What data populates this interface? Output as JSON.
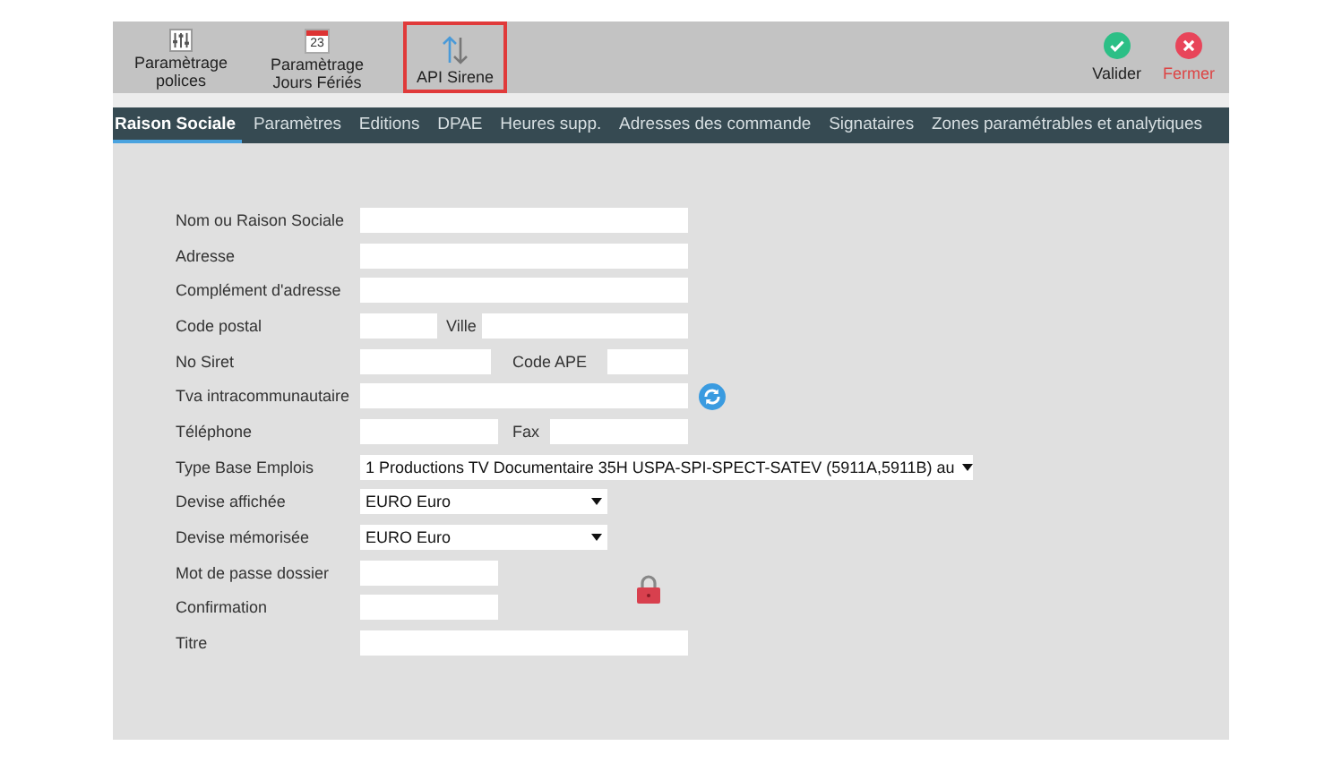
{
  "toolbar": {
    "buttons": [
      {
        "kind": "sliders",
        "label": "Paramètrage polices",
        "highlighted": false
      },
      {
        "kind": "calendar",
        "label": "Paramètrage Jours Fériés",
        "day": "23",
        "highlighted": false
      },
      {
        "kind": "arrows",
        "label": "API Sirene",
        "highlighted": true
      }
    ],
    "actions": [
      {
        "kind": "ok",
        "label": "Valider"
      },
      {
        "kind": "close",
        "label": "Fermer"
      }
    ]
  },
  "tabs": [
    {
      "label": "Raison Sociale",
      "selected": true
    },
    {
      "label": "Paramètres",
      "selected": false
    },
    {
      "label": "Editions",
      "selected": false
    },
    {
      "label": "DPAE",
      "selected": false
    },
    {
      "label": "Heures supp.",
      "selected": false
    },
    {
      "label": "Adresses des commande",
      "selected": false
    },
    {
      "label": "Signataires",
      "selected": false
    },
    {
      "label": "Zones paramétrables et analytiques",
      "selected": false
    }
  ],
  "form": {
    "rows": [
      {
        "label": "Nom ou Raison Sociale",
        "kind": "text"
      },
      {
        "label": "Adresse",
        "kind": "text"
      },
      {
        "label": "Complément d'adresse",
        "kind": "text"
      },
      {
        "label": "Code postal",
        "kind": "postal",
        "second_label": "Ville"
      },
      {
        "label": "No Siret",
        "kind": "siret",
        "second_label": "Code APE"
      },
      {
        "label": "Tva intracommunautaire",
        "kind": "refresh"
      },
      {
        "label": "Téléphone",
        "kind": "phone",
        "second_label": "Fax"
      },
      {
        "label": "Type Base Emplois",
        "kind": "wide-select",
        "value": "1 Productions TV Documentaire 35H USPA-SPI-SPECT-SATEV (5911A,5911B) au"
      },
      {
        "label": "Devise affichée",
        "kind": "select",
        "value": "EURO Euro"
      },
      {
        "label": "Devise mémorisée",
        "kind": "select",
        "value": "EURO Euro"
      },
      {
        "label": "Mot de passe dossier",
        "kind": "password",
        "lock": true
      },
      {
        "label": "Confirmation",
        "kind": "password",
        "lock": false
      },
      {
        "label": "Titre",
        "kind": "text"
      }
    ]
  }
}
